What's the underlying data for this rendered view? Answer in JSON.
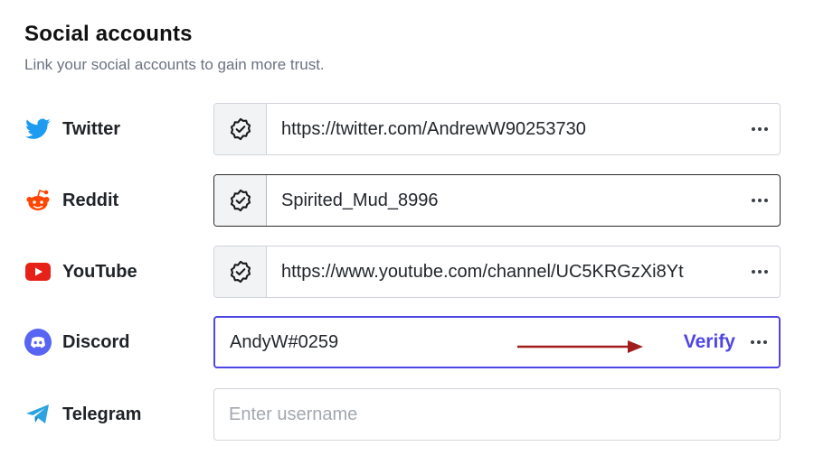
{
  "section": {
    "title": "Social accounts",
    "subtitle": "Link your social accounts to gain more trust."
  },
  "accounts": [
    {
      "platform": "Twitter",
      "icon": "twitter-bird-icon",
      "color": "#1d9bf0",
      "value": "https://twitter.com/AndrewW90253730",
      "verified": true
    },
    {
      "platform": "Reddit",
      "icon": "reddit-alien-icon",
      "color": "#ff4500",
      "value": "Spirited_Mud_8996",
      "verified": true
    },
    {
      "platform": "YouTube",
      "icon": "youtube-play-icon",
      "color": "#ff0000",
      "value": "https://www.youtube.com/channel/UC5KRGzXi8Yt",
      "verified": true
    },
    {
      "platform": "Discord",
      "icon": "discord-icon",
      "color": "#5865f2",
      "value": "AndyW#0259",
      "verified": false,
      "action": "Verify"
    },
    {
      "platform": "Telegram",
      "icon": "telegram-plane-icon",
      "color": "#2aa3e0",
      "value": "",
      "placeholder": "Enter username"
    }
  ],
  "colors": {
    "accent": "#4f46e5",
    "annotation_arrow": "#a11d1d"
  }
}
